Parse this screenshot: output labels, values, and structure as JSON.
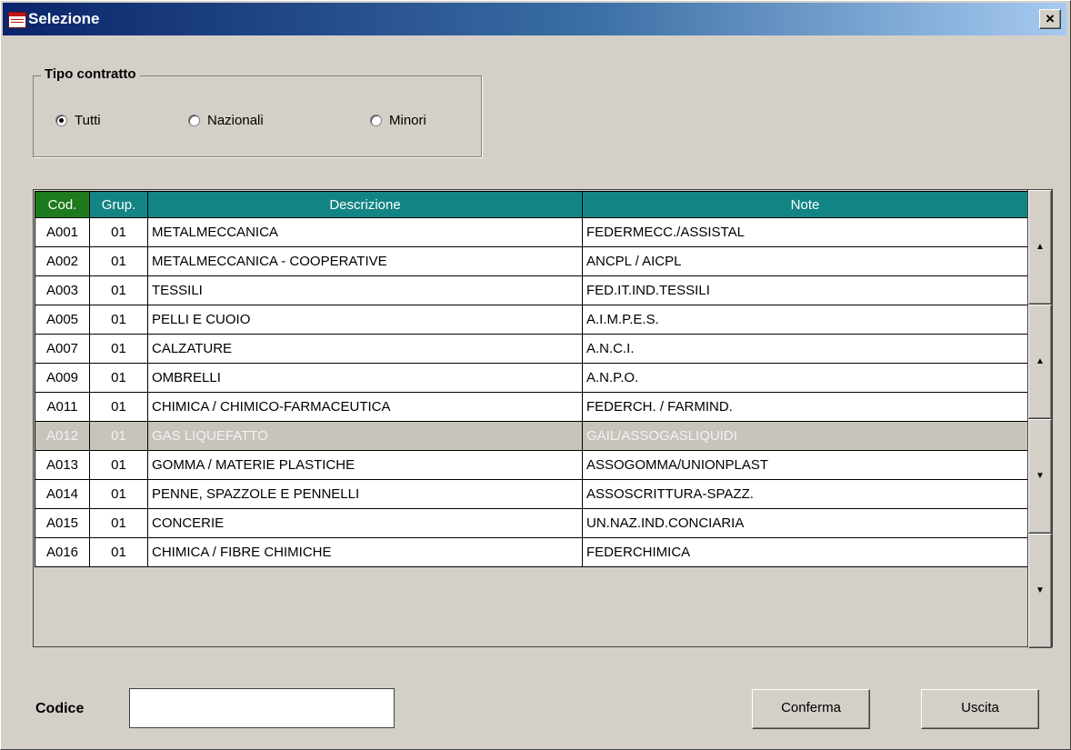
{
  "window": {
    "title": "Selezione",
    "close_label": "×"
  },
  "tipo_contratto": {
    "legend": "Tipo contratto",
    "options": [
      {
        "label": "Tutti",
        "selected": true
      },
      {
        "label": "Nazionali",
        "selected": false
      },
      {
        "label": "Minori",
        "selected": false
      }
    ]
  },
  "grid": {
    "columns": [
      "Cod.",
      "Grup.",
      "Descrizione",
      "Note"
    ],
    "rows": [
      {
        "cod": "A001",
        "grup": "01",
        "descrizione": "METALMECCANICA",
        "note": "FEDERMECC./ASSISTAL"
      },
      {
        "cod": "A002",
        "grup": "01",
        "descrizione": "METALMECCANICA - COOPERATIVE",
        "note": "ANCPL / AICPL"
      },
      {
        "cod": "A003",
        "grup": "01",
        "descrizione": "TESSILI",
        "note": "FED.IT.IND.TESSILI"
      },
      {
        "cod": "A005",
        "grup": "01",
        "descrizione": "PELLI E CUOIO",
        "note": "A.I.M.P.E.S."
      },
      {
        "cod": "A007",
        "grup": "01",
        "descrizione": "CALZATURE",
        "note": "A.N.C.I."
      },
      {
        "cod": "A009",
        "grup": "01",
        "descrizione": "OMBRELLI",
        "note": "A.N.P.O."
      },
      {
        "cod": "A011",
        "grup": "01",
        "descrizione": "CHIMICA / CHIMICO-FARMACEUTICA",
        "note": "FEDERCH. / FARMIND."
      },
      {
        "cod": "A012",
        "grup": "01",
        "descrizione": "GAS LIQUEFATTO",
        "note": "GAIL/ASSOGASLIQUIDI",
        "disabled": true
      },
      {
        "cod": "A013",
        "grup": "01",
        "descrizione": "GOMMA / MATERIE PLASTICHE",
        "note": "ASSOGOMMA/UNIONPLAST"
      },
      {
        "cod": "A014",
        "grup": "01",
        "descrizione": "PENNE, SPAZZOLE E PENNELLI",
        "note": "ASSOSCRITTURA-SPAZZ."
      },
      {
        "cod": "A015",
        "grup": "01",
        "descrizione": "CONCERIE",
        "note": "UN.NAZ.IND.CONCIARIA"
      },
      {
        "cod": "A016",
        "grup": "01",
        "descrizione": "CHIMICA / FIBRE CHIMICHE",
        "note": "FEDERCHIMICA"
      }
    ],
    "scroll_buttons": [
      {
        "name": "scroll-first-button",
        "glyph": "▲"
      },
      {
        "name": "scroll-page-up-button",
        "glyph": "▲"
      },
      {
        "name": "scroll-page-down-button",
        "glyph": "▼"
      },
      {
        "name": "scroll-last-button",
        "glyph": "▼"
      }
    ]
  },
  "footer": {
    "codice_label": "Codice",
    "codice_value": "",
    "conferma_label": "Conferma",
    "uscita_label": "Uscita"
  },
  "colors": {
    "title_gradient_start": "#0a246a",
    "header_teal": "#138484",
    "header_cod_green": "#1d7b1d",
    "window_bg": "#d4d0c8",
    "disabled_row_bg": "#c8c4bc"
  }
}
